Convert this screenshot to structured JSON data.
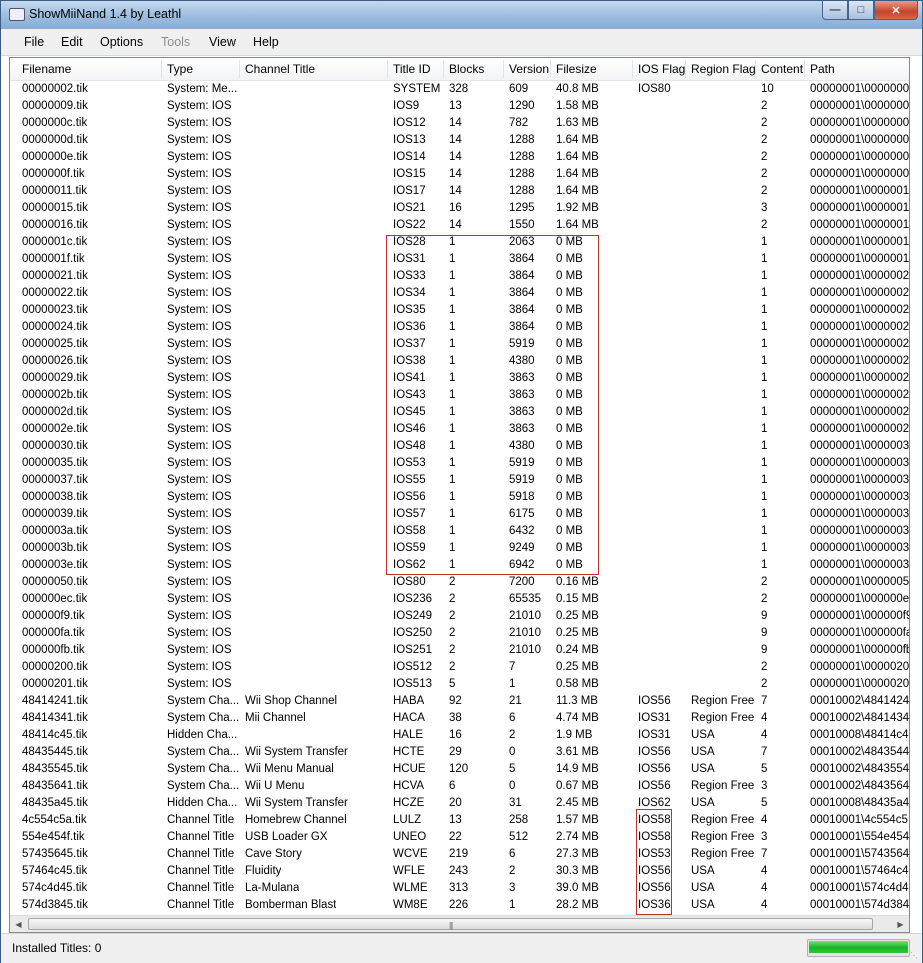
{
  "window": {
    "title": "ShowMiiNand 1.4 by Leathl"
  },
  "menu": {
    "file": "File",
    "edit": "Edit",
    "options": "Options",
    "tools": "Tools",
    "view": "View",
    "help": "Help"
  },
  "columns": [
    "Filename",
    "Type",
    "Channel Title",
    "Title ID",
    "Blocks",
    "Version",
    "Filesize",
    "IOS Flag",
    "Region Flag",
    "Content",
    "Path"
  ],
  "rows": [
    [
      "00000002.tik",
      "System: Me...",
      "",
      "SYSTEM",
      "328",
      "609",
      "40.8 MB",
      "IOS80",
      "",
      "10",
      "00000001\\0000000"
    ],
    [
      "00000009.tik",
      "System: IOS",
      "",
      "IOS9",
      "13",
      "1290",
      "1.58 MB",
      "",
      "",
      "2",
      "00000001\\0000000"
    ],
    [
      "0000000c.tik",
      "System: IOS",
      "",
      "IOS12",
      "14",
      "782",
      "1.63 MB",
      "",
      "",
      "2",
      "00000001\\0000000"
    ],
    [
      "0000000d.tik",
      "System: IOS",
      "",
      "IOS13",
      "14",
      "1288",
      "1.64 MB",
      "",
      "",
      "2",
      "00000001\\0000000"
    ],
    [
      "0000000e.tik",
      "System: IOS",
      "",
      "IOS14",
      "14",
      "1288",
      "1.64 MB",
      "",
      "",
      "2",
      "00000001\\0000000"
    ],
    [
      "0000000f.tik",
      "System: IOS",
      "",
      "IOS15",
      "14",
      "1288",
      "1.64 MB",
      "",
      "",
      "2",
      "00000001\\0000000"
    ],
    [
      "00000011.tik",
      "System: IOS",
      "",
      "IOS17",
      "14",
      "1288",
      "1.64 MB",
      "",
      "",
      "2",
      "00000001\\0000001"
    ],
    [
      "00000015.tik",
      "System: IOS",
      "",
      "IOS21",
      "16",
      "1295",
      "1.92 MB",
      "",
      "",
      "3",
      "00000001\\0000001"
    ],
    [
      "00000016.tik",
      "System: IOS",
      "",
      "IOS22",
      "14",
      "1550",
      "1.64 MB",
      "",
      "",
      "2",
      "00000001\\0000001"
    ],
    [
      "0000001c.tik",
      "System: IOS",
      "",
      "IOS28",
      "1",
      "2063",
      "0 MB",
      "",
      "",
      "1",
      "00000001\\0000001"
    ],
    [
      "0000001f.tik",
      "System: IOS",
      "",
      "IOS31",
      "1",
      "3864",
      "0 MB",
      "",
      "",
      "1",
      "00000001\\0000001"
    ],
    [
      "00000021.tik",
      "System: IOS",
      "",
      "IOS33",
      "1",
      "3864",
      "0 MB",
      "",
      "",
      "1",
      "00000001\\0000002"
    ],
    [
      "00000022.tik",
      "System: IOS",
      "",
      "IOS34",
      "1",
      "3864",
      "0 MB",
      "",
      "",
      "1",
      "00000001\\0000002"
    ],
    [
      "00000023.tik",
      "System: IOS",
      "",
      "IOS35",
      "1",
      "3864",
      "0 MB",
      "",
      "",
      "1",
      "00000001\\0000002"
    ],
    [
      "00000024.tik",
      "System: IOS",
      "",
      "IOS36",
      "1",
      "3864",
      "0 MB",
      "",
      "",
      "1",
      "00000001\\0000002"
    ],
    [
      "00000025.tik",
      "System: IOS",
      "",
      "IOS37",
      "1",
      "5919",
      "0 MB",
      "",
      "",
      "1",
      "00000001\\0000002"
    ],
    [
      "00000026.tik",
      "System: IOS",
      "",
      "IOS38",
      "1",
      "4380",
      "0 MB",
      "",
      "",
      "1",
      "00000001\\0000002"
    ],
    [
      "00000029.tik",
      "System: IOS",
      "",
      "IOS41",
      "1",
      "3863",
      "0 MB",
      "",
      "",
      "1",
      "00000001\\0000002"
    ],
    [
      "0000002b.tik",
      "System: IOS",
      "",
      "IOS43",
      "1",
      "3863",
      "0 MB",
      "",
      "",
      "1",
      "00000001\\0000002"
    ],
    [
      "0000002d.tik",
      "System: IOS",
      "",
      "IOS45",
      "1",
      "3863",
      "0 MB",
      "",
      "",
      "1",
      "00000001\\0000002"
    ],
    [
      "0000002e.tik",
      "System: IOS",
      "",
      "IOS46",
      "1",
      "3863",
      "0 MB",
      "",
      "",
      "1",
      "00000001\\0000002"
    ],
    [
      "00000030.tik",
      "System: IOS",
      "",
      "IOS48",
      "1",
      "4380",
      "0 MB",
      "",
      "",
      "1",
      "00000001\\0000003"
    ],
    [
      "00000035.tik",
      "System: IOS",
      "",
      "IOS53",
      "1",
      "5919",
      "0 MB",
      "",
      "",
      "1",
      "00000001\\0000003"
    ],
    [
      "00000037.tik",
      "System: IOS",
      "",
      "IOS55",
      "1",
      "5919",
      "0 MB",
      "",
      "",
      "1",
      "00000001\\0000003"
    ],
    [
      "00000038.tik",
      "System: IOS",
      "",
      "IOS56",
      "1",
      "5918",
      "0 MB",
      "",
      "",
      "1",
      "00000001\\0000003"
    ],
    [
      "00000039.tik",
      "System: IOS",
      "",
      "IOS57",
      "1",
      "6175",
      "0 MB",
      "",
      "",
      "1",
      "00000001\\0000003"
    ],
    [
      "0000003a.tik",
      "System: IOS",
      "",
      "IOS58",
      "1",
      "6432",
      "0 MB",
      "",
      "",
      "1",
      "00000001\\0000003"
    ],
    [
      "0000003b.tik",
      "System: IOS",
      "",
      "IOS59",
      "1",
      "9249",
      "0 MB",
      "",
      "",
      "1",
      "00000001\\0000003"
    ],
    [
      "0000003e.tik",
      "System: IOS",
      "",
      "IOS62",
      "1",
      "6942",
      "0 MB",
      "",
      "",
      "1",
      "00000001\\0000003"
    ],
    [
      "00000050.tik",
      "System: IOS",
      "",
      "IOS80",
      "2",
      "7200",
      "0.16 MB",
      "",
      "",
      "2",
      "00000001\\0000005"
    ],
    [
      "000000ec.tik",
      "System: IOS",
      "",
      "IOS236",
      "2",
      "65535",
      "0.15 MB",
      "",
      "",
      "2",
      "00000001\\000000e"
    ],
    [
      "000000f9.tik",
      "System: IOS",
      "",
      "IOS249",
      "2",
      "21010",
      "0.25 MB",
      "",
      "",
      "9",
      "00000001\\000000f9"
    ],
    [
      "000000fa.tik",
      "System: IOS",
      "",
      "IOS250",
      "2",
      "21010",
      "0.25 MB",
      "",
      "",
      "9",
      "00000001\\000000fa"
    ],
    [
      "000000fb.tik",
      "System: IOS",
      "",
      "IOS251",
      "2",
      "21010",
      "0.24 MB",
      "",
      "",
      "9",
      "00000001\\000000fb"
    ],
    [
      "00000200.tik",
      "System: IOS",
      "",
      "IOS512",
      "2",
      "7",
      "0.25 MB",
      "",
      "",
      "2",
      "00000001\\0000020"
    ],
    [
      "00000201.tik",
      "System: IOS",
      "",
      "IOS513",
      "5",
      "1",
      "0.58 MB",
      "",
      "",
      "2",
      "00000001\\0000020"
    ],
    [
      "48414241.tik",
      "System Cha...",
      "Wii Shop Channel",
      "HABA",
      "92",
      "21",
      "11.3 MB",
      "IOS56",
      "Region Free",
      "7",
      "00010002\\4841424"
    ],
    [
      "48414341.tik",
      "System Cha...",
      "Mii Channel",
      "HACA",
      "38",
      "6",
      "4.74 MB",
      "IOS31",
      "Region Free",
      "4",
      "00010002\\4841434"
    ],
    [
      "48414c45.tik",
      "Hidden Cha...",
      "",
      "HALE",
      "16",
      "2",
      "1.9 MB",
      "IOS31",
      "USA",
      "4",
      "00010008\\48414c4"
    ],
    [
      "48435445.tik",
      "System Cha...",
      "Wii System Transfer",
      "HCTE",
      "29",
      "0",
      "3.61 MB",
      "IOS56",
      "USA",
      "7",
      "00010002\\4843544"
    ],
    [
      "48435545.tik",
      "System Cha...",
      "Wii Menu Manual",
      "HCUE",
      "120",
      "5",
      "14.9 MB",
      "IOS56",
      "USA",
      "5",
      "00010002\\4843554"
    ],
    [
      "48435641.tik",
      "System Cha...",
      "Wii U Menu",
      "HCVA",
      "6",
      "0",
      "0.67 MB",
      "IOS56",
      "Region Free",
      "3",
      "00010002\\4843564"
    ],
    [
      "48435a45.tik",
      "Hidden Cha...",
      "Wii System Transfer",
      "HCZE",
      "20",
      "31",
      "2.45 MB",
      "IOS62",
      "USA",
      "5",
      "00010008\\48435a4"
    ],
    [
      "4c554c5a.tik",
      "Channel Title",
      "Homebrew Channel",
      "LULZ",
      "13",
      "258",
      "1.57 MB",
      "IOS58",
      "Region Free",
      "4",
      "00010001\\4c554c5"
    ],
    [
      "554e454f.tik",
      "Channel Title",
      "USB Loader GX",
      "UNEO",
      "22",
      "512",
      "2.74 MB",
      "IOS58",
      "Region Free",
      "3",
      "00010001\\554e454"
    ],
    [
      "57435645.tik",
      "Channel Title",
      "Cave Story",
      "WCVE",
      "219",
      "6",
      "27.3 MB",
      "IOS53",
      "Region Free",
      "7",
      "00010001\\5743564"
    ],
    [
      "57464c45.tik",
      "Channel Title",
      "Fluidity",
      "WFLE",
      "243",
      "2",
      "30.3 MB",
      "IOS56",
      "USA",
      "4",
      "00010001\\57464c4"
    ],
    [
      "574c4d45.tik",
      "Channel Title",
      "La-Mulana",
      "WLME",
      "313",
      "3",
      "39.0 MB",
      "IOS56",
      "USA",
      "4",
      "00010001\\574c4d4"
    ],
    [
      "574d3845.tik",
      "Channel Title",
      "Bomberman Blast",
      "WM8E",
      "226",
      "1",
      "28.2 MB",
      "IOS36",
      "USA",
      "4",
      "00010001\\574d384"
    ]
  ],
  "status": {
    "installed_titles_label": "Installed Titles:",
    "installed_titles_value": "0",
    "progress_fraction": 1.0
  },
  "colors": {
    "highlight_box": "#c0312b",
    "progress": "#16b424"
  }
}
